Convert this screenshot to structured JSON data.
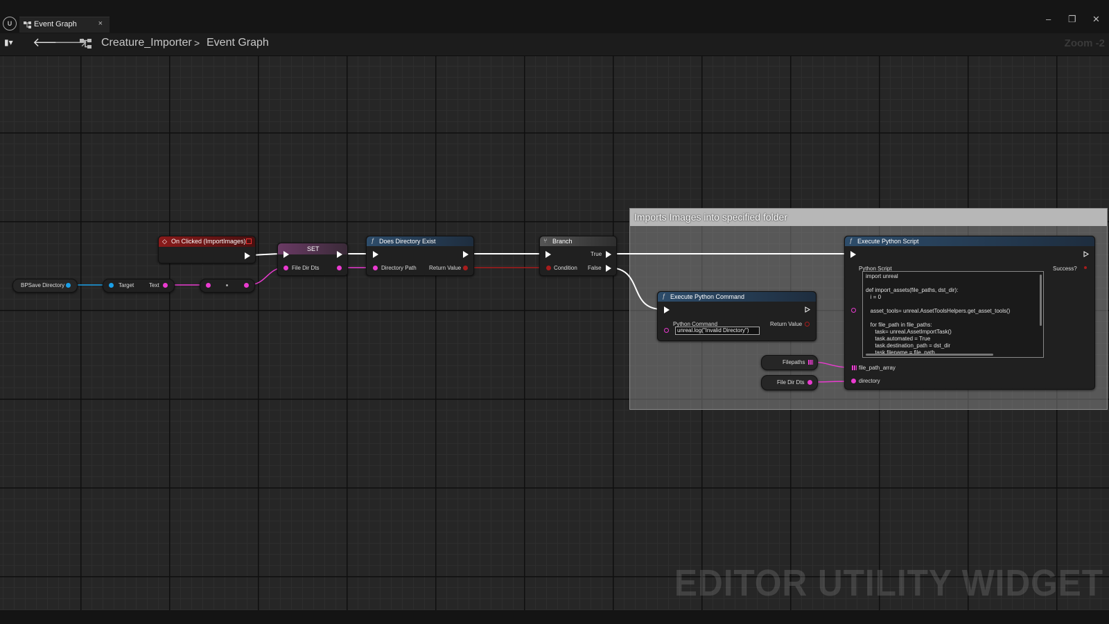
{
  "window": {
    "tab_title": "Event Graph",
    "tab_close": "×",
    "controls": {
      "minimize": "–",
      "restore": "❐",
      "close": "✕"
    }
  },
  "toolbar": {
    "breadcrumb": [
      "Creature_Importer",
      "Event Graph"
    ],
    "separator": ">",
    "zoom": "Zoom -2"
  },
  "comment": {
    "title": "Imports Images into specified folder"
  },
  "nodes": {
    "on_clicked": {
      "title": "On Clicked (ImportImages)"
    },
    "set": {
      "title": "SET",
      "pin": "File Dir Dts"
    },
    "does_dir_exist": {
      "title": "Does Directory Exist",
      "in": "Directory Path",
      "out": "Return Value"
    },
    "branch": {
      "title": "Branch",
      "condition": "Condition",
      "true": "True",
      "false": "False"
    },
    "bp_save_dir": {
      "label": "BPSave Directory"
    },
    "get_text": {
      "target": "Target",
      "text": "Text"
    },
    "exec_py_cmd": {
      "title": "Execute Python Command",
      "in": "Python Command",
      "value": "unreal.log(\"Invalid Directory\")",
      "out": "Return Value"
    },
    "exec_py_script": {
      "title": "Execute Python Script",
      "script_label": "Python Script",
      "success": "Success?",
      "pin_file_paths": "file_path_array",
      "pin_directory": "directory",
      "code": "import unreal\n\ndef import_assets(file_paths, dst_dir):\n   i = 0\n\n   asset_tools= unreal.AssetToolsHelpers.get_asset_tools()\n\n   for file_path in file_paths:\n      task= unreal.AssetImportTask()\n      task.automated = True\n      task.destination_path = dst_dir\n      task.filename = file_path"
    },
    "filepaths_var": {
      "label": "Filepaths"
    },
    "file_dir_dts_var": {
      "label": "File Dir Dts"
    }
  },
  "watermark": "EDITOR UTILITY WIDGET",
  "colors": {
    "event_header": "#8a1a1a",
    "function_header": "#2d4c6a",
    "branch_header": "#4a4a4a",
    "text_pin": "#ea3bd0",
    "object_pin": "#1aa0e8",
    "bool_pin": "#a81c1c",
    "exec": "#ffffff"
  }
}
